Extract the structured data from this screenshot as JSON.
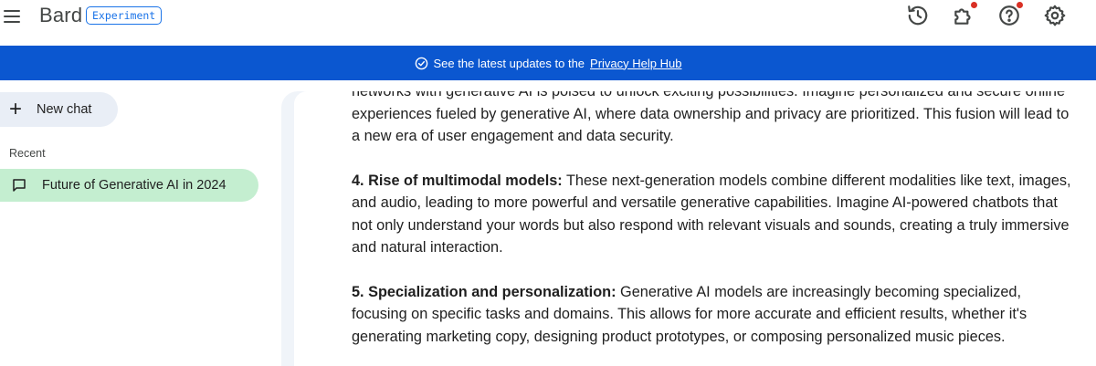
{
  "app": {
    "brand": "Bard",
    "badge": "Experiment"
  },
  "header_icons": [
    {
      "icon": "history-icon"
    },
    {
      "icon": "extensions-icon",
      "notification": true
    },
    {
      "icon": "help-icon",
      "notification": true
    },
    {
      "icon": "settings-icon"
    }
  ],
  "banner": {
    "text": "See the latest updates to the",
    "link": "Privacy Help Hub",
    "icon": "check-circle-icon"
  },
  "sidebar": {
    "new_chat_label": "New chat",
    "recent_label": "Recent",
    "chats": [
      {
        "title": "Future of Generative AI in 2024",
        "active": true
      }
    ]
  },
  "response": {
    "paragraphs": [
      {
        "heading": "",
        "text": "networks with generative AI is poised to unlock exciting possibilities. Imagine personalized and secure online experiences fueled by generative AI, where data ownership and privacy are prioritized. This fusion will lead to a new era of user engagement and data security."
      },
      {
        "heading": "4. Rise of multimodal models:",
        "text": "These next-generation models combine different modalities like text, images, and audio, leading to more powerful and versatile generative capabilities. Imagine AI-powered chatbots that not only understand your words but also respond with relevant visuals and sounds, creating a truly immersive and natural interaction."
      },
      {
        "heading": "5. Specialization and personalization:",
        "text": "Generative AI models are increasingly becoming specialized, focusing on specific tasks and domains. This allows for more accurate and efficient results, whether it's generating marketing copy, designing product prototypes, or composing personalized music pieces."
      }
    ]
  },
  "colors": {
    "banner_bg": "#0b57d0",
    "badge": "#1a73e8",
    "active_chat_bg": "#c4eed0",
    "new_chat_bg": "#e9eef6",
    "notification_dot": "#d93025"
  }
}
